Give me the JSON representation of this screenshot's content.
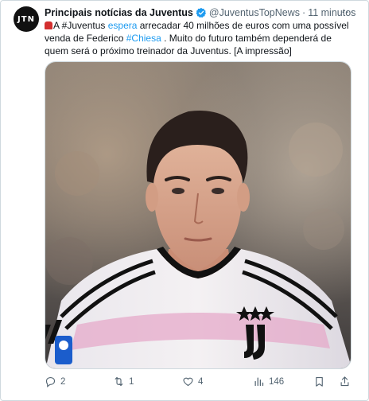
{
  "tweet": {
    "avatar_text": "JTN",
    "display_name": "Principais notícias da Juventus",
    "handle": "@JuventusTopNews",
    "separator": "·",
    "time": "11 minutos",
    "more_label": "···",
    "text": {
      "part1": "A #Juventus ",
      "highlight": "espera",
      "part2": " arrecadar 40 milhões de euros com uma possível venda de Federico ",
      "hashtag": "#Chiesa",
      "part3": " . Muito do futuro também dependerá de quem será o próximo treinador da Juventus. [A impressão]"
    }
  },
  "actions": {
    "replies": "2",
    "retweets": "1",
    "likes": "4",
    "views": "146"
  },
  "colors": {
    "accent": "#1d9bf0",
    "muted": "#536471",
    "text": "#0f1419"
  }
}
